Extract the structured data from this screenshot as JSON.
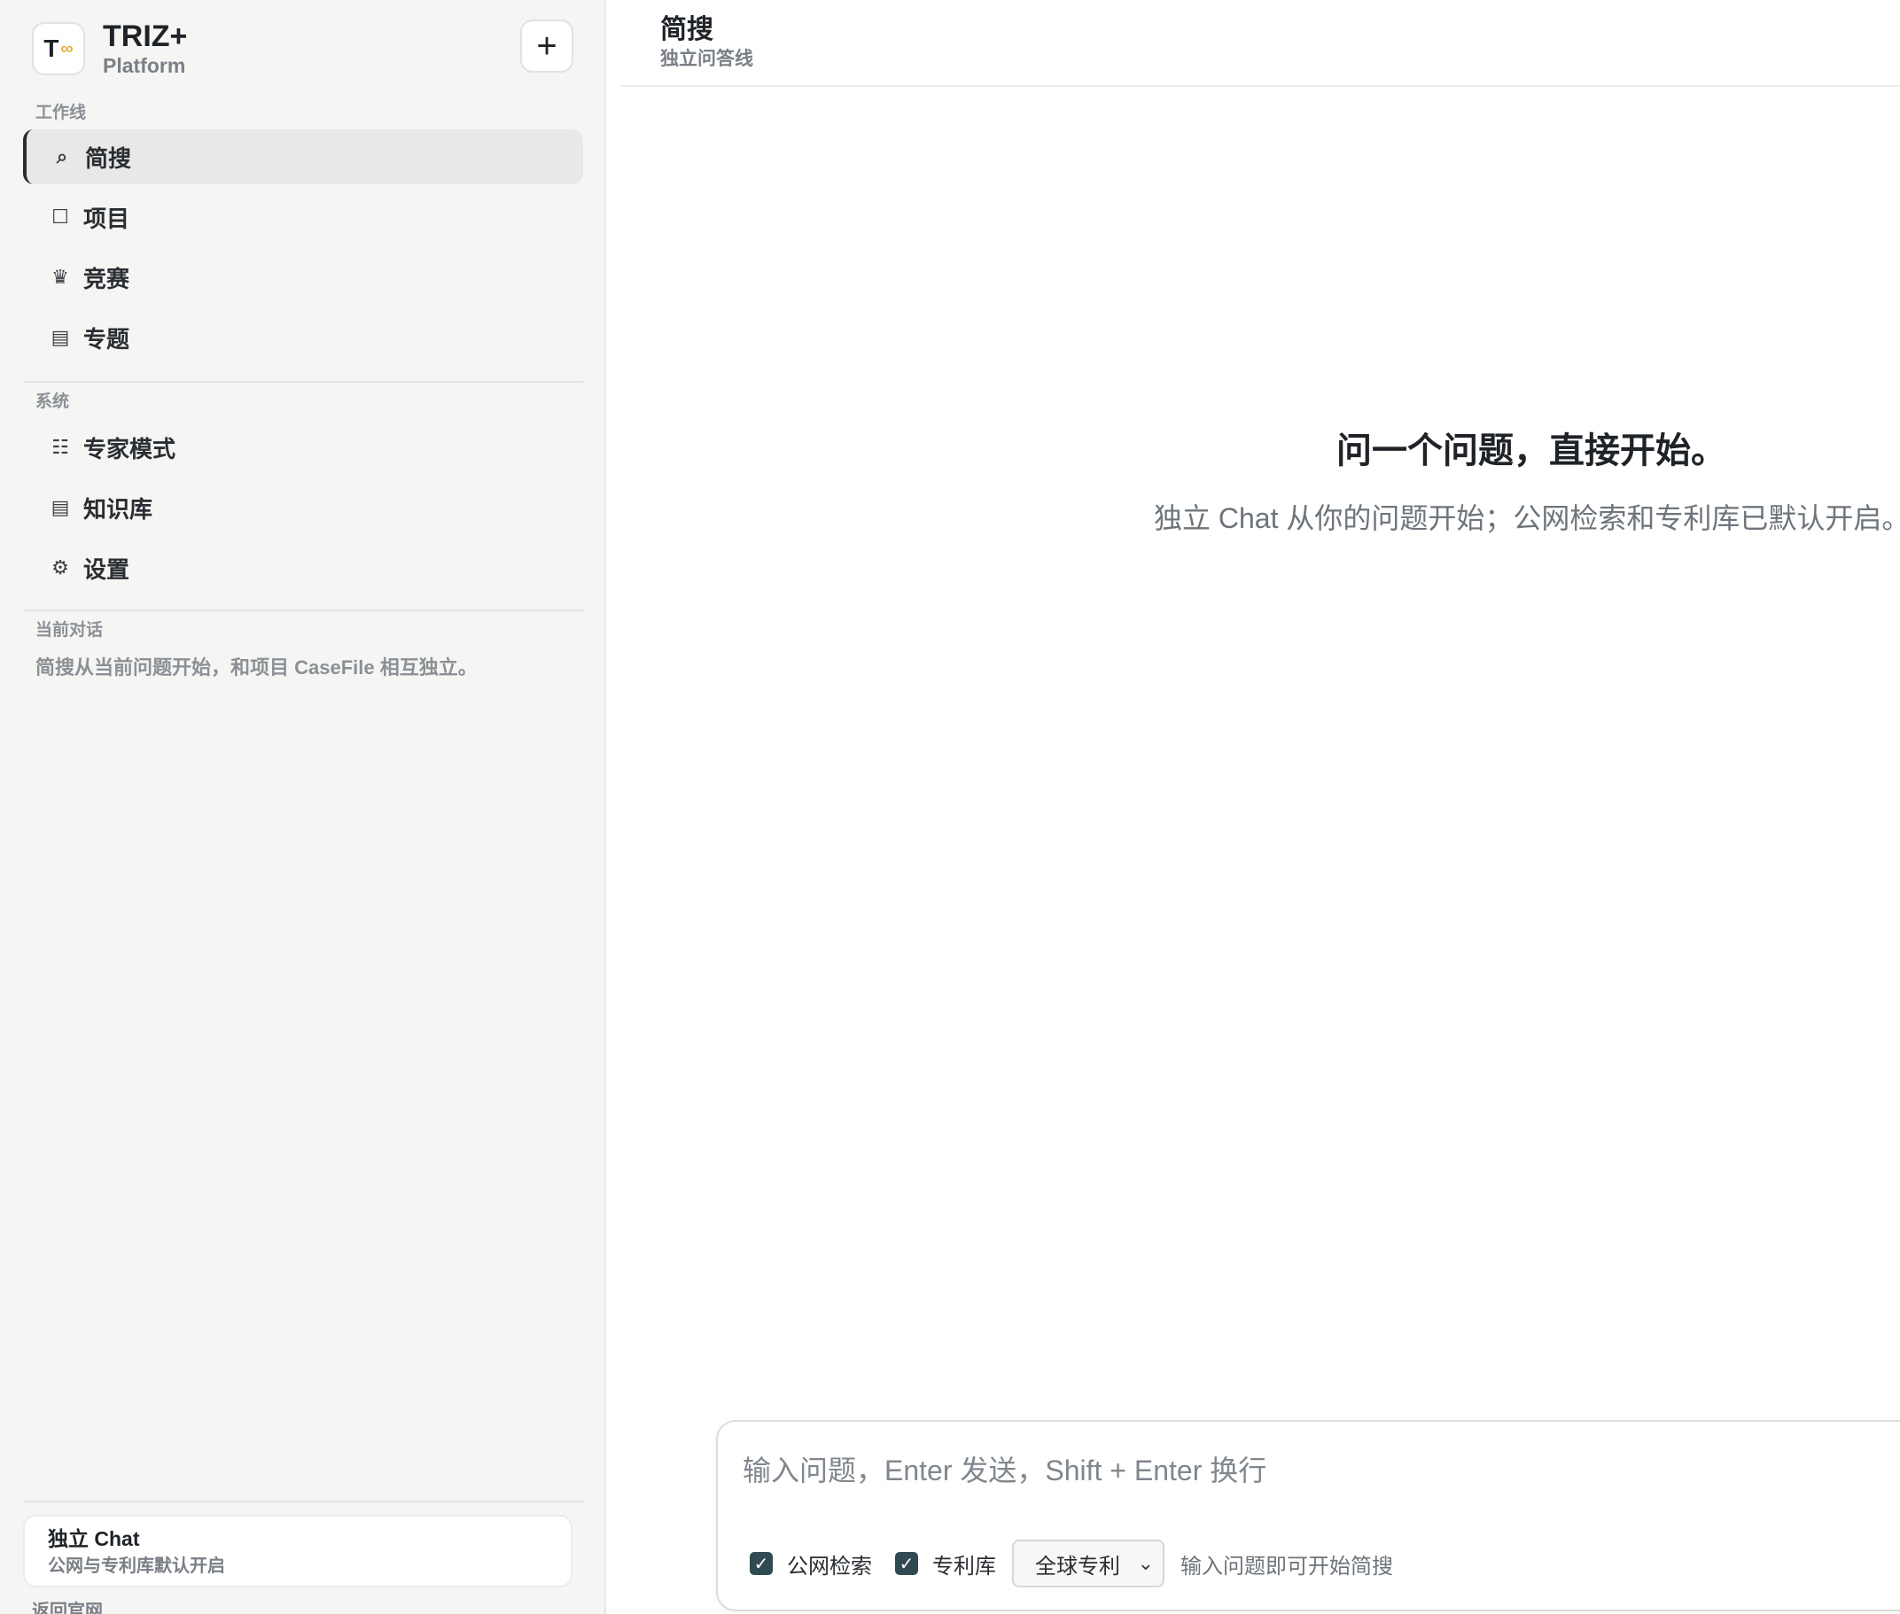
{
  "brand": {
    "logo_letter": "T",
    "logo_mark": "∞",
    "title": "TRIZ+",
    "subtitle": "Platform"
  },
  "sidebar": {
    "new_button": "+",
    "workline_label": "工作线",
    "workline_items": [
      {
        "label": "简搜",
        "icon": "search-icon",
        "glyph": "⌕",
        "active": true
      },
      {
        "label": "项目",
        "icon": "square-icon",
        "glyph": "☐",
        "active": false
      },
      {
        "label": "竞赛",
        "icon": "crown-icon",
        "glyph": "♛",
        "active": false
      },
      {
        "label": "专题",
        "icon": "list-icon",
        "glyph": "▤",
        "active": false
      }
    ],
    "system_label": "系统",
    "system_items": [
      {
        "label": "专家模式",
        "icon": "grid-icon",
        "glyph": "☷"
      },
      {
        "label": "知识库",
        "icon": "book-icon",
        "glyph": "▤"
      },
      {
        "label": "设置",
        "icon": "gear-icon",
        "glyph": "⚙"
      }
    ],
    "conversation_label": "当前对话",
    "conversation_desc": "简搜从当前问题开始，和项目 CaseFile 相互独立。",
    "chat_card": {
      "title": "独立 Chat",
      "subtitle": "公网与专利库默认开启"
    },
    "back_link": "返回官网"
  },
  "main": {
    "title": "简搜",
    "subtitle": "独立问答线",
    "hero_title": "问一个问题，直接开始。",
    "hero_subtitle": "独立 Chat 从你的问题开始；公网检索和专利库已默认开启。"
  },
  "composer": {
    "placeholder": "输入问题，Enter 发送，Shift + Enter 换行",
    "public_search_label": "公网检索",
    "public_search_checked": true,
    "patent_db_label": "专利库",
    "patent_db_checked": true,
    "scope_selected": "全球专利",
    "hint": "输入问题即可开始简搜"
  },
  "colors": {
    "accent": "#2f4a52",
    "sidebar_bg": "#f5f5f3",
    "logo_mark": "#e3b33c"
  }
}
